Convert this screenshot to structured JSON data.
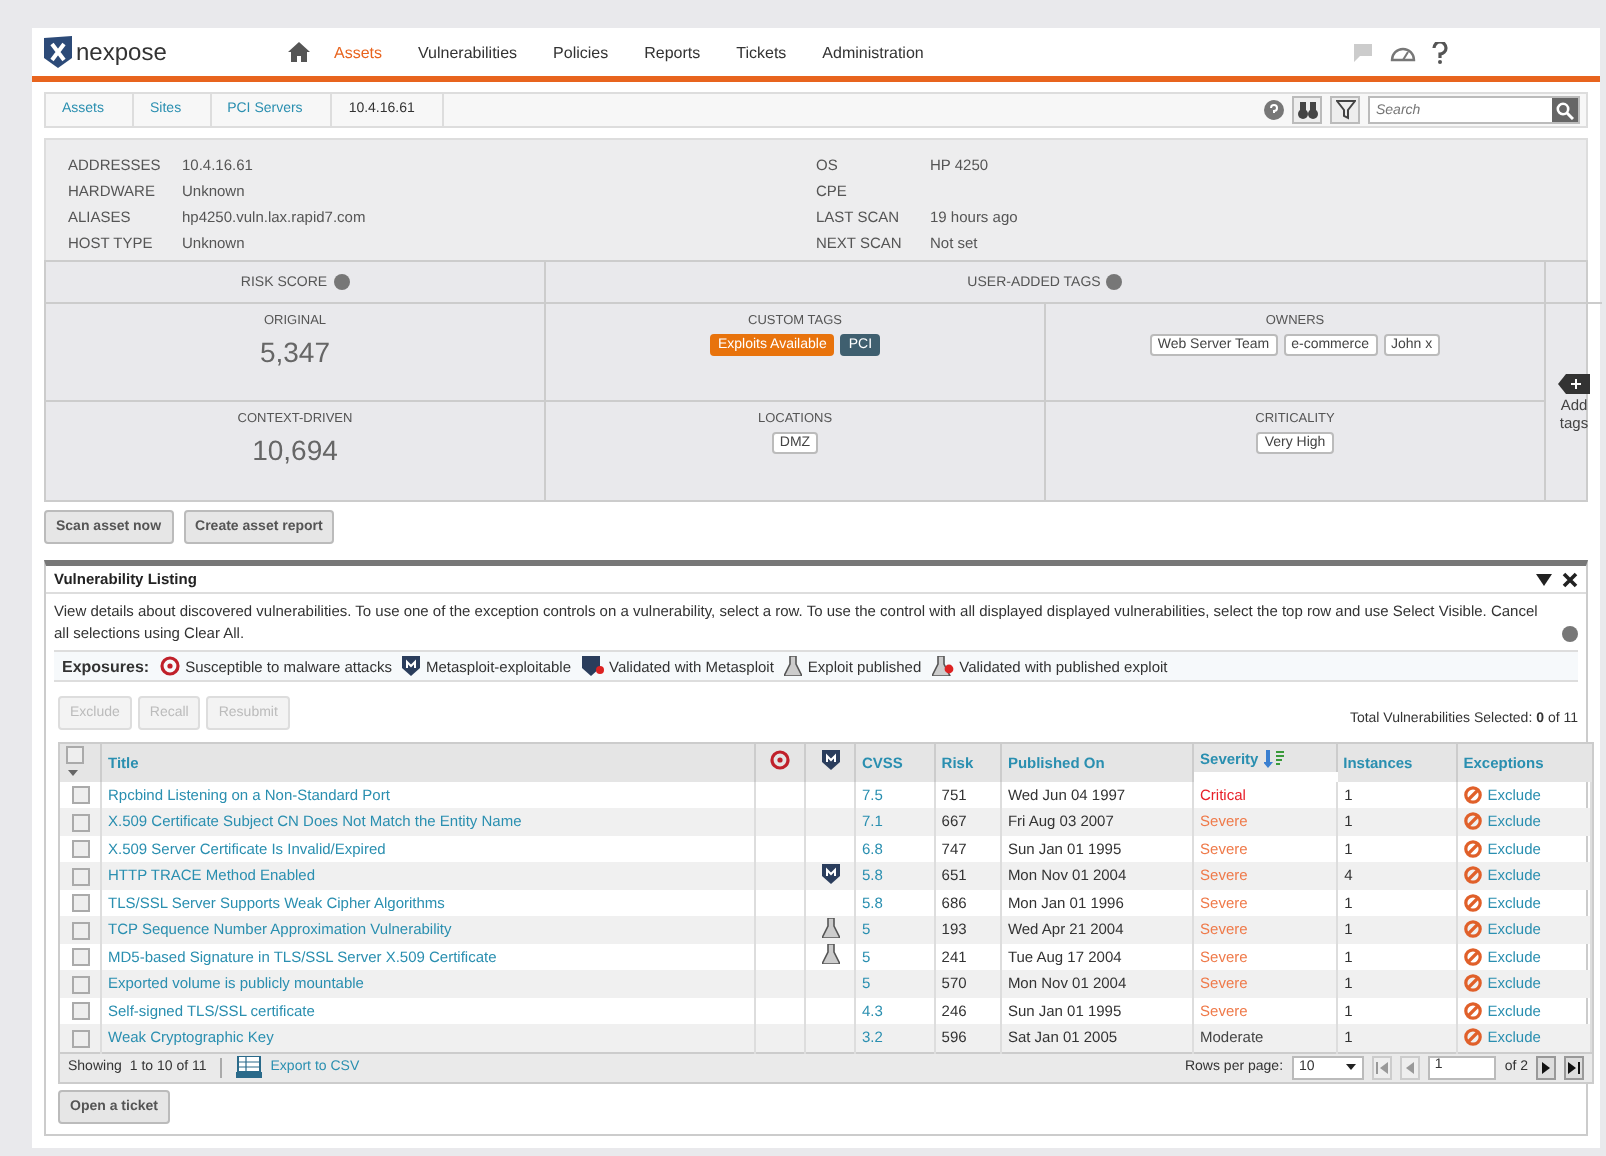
{
  "brand": "nexpose",
  "nav": [
    {
      "label": "Assets",
      "selected": true
    },
    {
      "label": "Vulnerabilities",
      "selected": false
    },
    {
      "label": "Policies",
      "selected": false
    },
    {
      "label": "Reports",
      "selected": false
    },
    {
      "label": "Tickets",
      "selected": false
    },
    {
      "label": "Administration",
      "selected": false
    }
  ],
  "breadcrumbs": [
    "Assets",
    "Sites",
    "PCI Servers",
    "10.4.16.61"
  ],
  "search": {
    "placeholder": "Search"
  },
  "asset_left": [
    {
      "label": "ADDRESSES",
      "value": "10.4.16.61"
    },
    {
      "label": "HARDWARE",
      "value": "Unknown"
    },
    {
      "label": "ALIASES",
      "value": "hp4250.vuln.lax.rapid7.com"
    },
    {
      "label": "HOST TYPE",
      "value": "Unknown"
    }
  ],
  "asset_right": [
    {
      "label": "OS",
      "value": "HP 4250"
    },
    {
      "label": "CPE"
    },
    {
      "label": "LAST SCAN",
      "value": "19 hours ago"
    },
    {
      "label": "NEXT SCAN",
      "value": "Not set"
    }
  ],
  "risk": {
    "title": "RISK SCORE",
    "original_label": "ORIGINAL",
    "original": "5,347",
    "context_label": "CONTEXT-DRIVEN",
    "context": "10,694"
  },
  "tags": {
    "title": "USER-ADDED TAGS",
    "add_label": "Add tags",
    "groups": [
      {
        "label": "CUSTOM TAGS",
        "tags": [
          {
            "text": "Exploits Available",
            "color": "#e8730c"
          },
          {
            "text": "PCI",
            "color": "#3f5f6f"
          }
        ]
      },
      {
        "label": "OWNERS",
        "tags": [
          {
            "text": "Web Server Team"
          },
          {
            "text": "e-commerce"
          },
          {
            "text": "John x"
          }
        ]
      },
      {
        "label": "LOCATIONS",
        "tags": [
          {
            "text": "DMZ"
          }
        ]
      },
      {
        "label": "CRITICALITY",
        "tags": [
          {
            "text": "Very High"
          }
        ]
      }
    ]
  },
  "asset_buttons": [
    "Scan asset now",
    "Create asset report"
  ],
  "listing": {
    "title": "Vulnerability Listing",
    "description": "View details about discovered vulnerabilities. To use one of the exception controls on a vulnerability, select a row. To use the control with all displayed displayed vulnerabilities, select the top row and use Select Visible. Cancel all selections using Clear All.",
    "exposures_label": "Exposures:",
    "exposures": [
      {
        "kind": "malware",
        "text": "Susceptible to malware attacks"
      },
      {
        "kind": "metasploit",
        "text": "Metasploit-exploitable"
      },
      {
        "kind": "validated-metasploit",
        "text": "Validated with Metasploit"
      },
      {
        "kind": "exploit",
        "text": "Exploit published"
      },
      {
        "kind": "validated-exploit",
        "text": "Validated with published exploit"
      }
    ],
    "actions": [
      {
        "label": "Exclude",
        "disabled": true
      },
      {
        "label": "Recall",
        "disabled": true
      },
      {
        "label": "Resubmit",
        "disabled": true
      }
    ],
    "selected_label": "Total Vulnerabilities Selected:",
    "selected_count": "0",
    "selected_total": "of 11",
    "header_checked": false,
    "columns": [
      "Title",
      "CVSS",
      "Risk",
      "Published On",
      "Severity",
      "Instances",
      "Exceptions"
    ],
    "rows": [
      {
        "checked": false,
        "title": "Rpcbind Listening on a Non-Standard Port",
        "kind": "plain",
        "cvss": "7.5",
        "risk": "751",
        "published": "Wed Jun 04 1997",
        "severity": "Critical",
        "color": "#e8202a",
        "instances": "1",
        "exception": "Exclude"
      },
      {
        "checked": false,
        "title": "X.509 Certificate Subject CN Does Not Match the Entity Name",
        "kind": "plain",
        "cvss": "7.1",
        "risk": "667",
        "published": "Fri Aug 03 2007",
        "severity": "Severe",
        "color": "#ef7a4a",
        "instances": "1",
        "exception": "Exclude"
      },
      {
        "checked": false,
        "title": "X.509 Server Certificate Is Invalid/Expired",
        "kind": "plain",
        "cvss": "6.8",
        "risk": "747",
        "published": "Sun Jan 01 1995",
        "severity": "Severe",
        "color": "#ef7a4a",
        "instances": "1",
        "exception": "Exclude"
      },
      {
        "checked": false,
        "title": "HTTP TRACE Method Enabled",
        "kind": "metasploit",
        "cvss": "5.8",
        "risk": "651",
        "published": "Mon Nov 01 2004",
        "severity": "Severe",
        "color": "#ef7a4a",
        "instances": "4",
        "exception": "Exclude"
      },
      {
        "checked": false,
        "title": "TLS/SSL Server Supports Weak Cipher Algorithms",
        "kind": "plain",
        "cvss": "5.8",
        "risk": "686",
        "published": "Mon Jan 01 1996",
        "severity": "Severe",
        "color": "#ef7a4a",
        "instances": "1",
        "exception": "Exclude"
      },
      {
        "checked": false,
        "title": "TCP Sequence Number Approximation Vulnerability",
        "kind": "exploit",
        "cvss": "5",
        "risk": "193",
        "published": "Wed Apr 21 2004",
        "severity": "Severe",
        "color": "#ef7a4a",
        "instances": "1",
        "exception": "Exclude"
      },
      {
        "checked": false,
        "title": "MD5-based Signature in TLS/SSL Server X.509 Certificate",
        "kind": "exploit",
        "cvss": "5",
        "risk": "241",
        "published": "Tue Aug 17 2004",
        "severity": "Severe",
        "color": "#ef7a4a",
        "instances": "1",
        "exception": "Exclude"
      },
      {
        "checked": false,
        "title": "Exported volume is publicly mountable",
        "kind": "plain",
        "cvss": "5",
        "risk": "570",
        "published": "Mon Nov 01 2004",
        "severity": "Severe",
        "color": "#ef7a4a",
        "instances": "1",
        "exception": "Exclude"
      },
      {
        "checked": false,
        "title": "Self-signed TLS/SSL certificate",
        "kind": "plain",
        "cvss": "4.3",
        "risk": "246",
        "published": "Sun Jan 01 1995",
        "severity": "Severe",
        "color": "#ef7a4a",
        "instances": "1",
        "exception": "Exclude"
      },
      {
        "checked": false,
        "title": "Weak Cryptographic Key",
        "kind": "plain",
        "cvss": "3.2",
        "risk": "596",
        "published": "Sat Jan 01 2005",
        "severity": "Moderate",
        "color": "#444444",
        "instances": "1",
        "exception": "Exclude"
      }
    ],
    "showing_label": "Showing",
    "showing": "1 to 10 of 11",
    "export": "Export to CSV",
    "rows_per_page_label": "Rows per page:",
    "rows_per_page": "10",
    "page": "1",
    "page_total": "of 2",
    "ticket_button": "Open a ticket"
  }
}
